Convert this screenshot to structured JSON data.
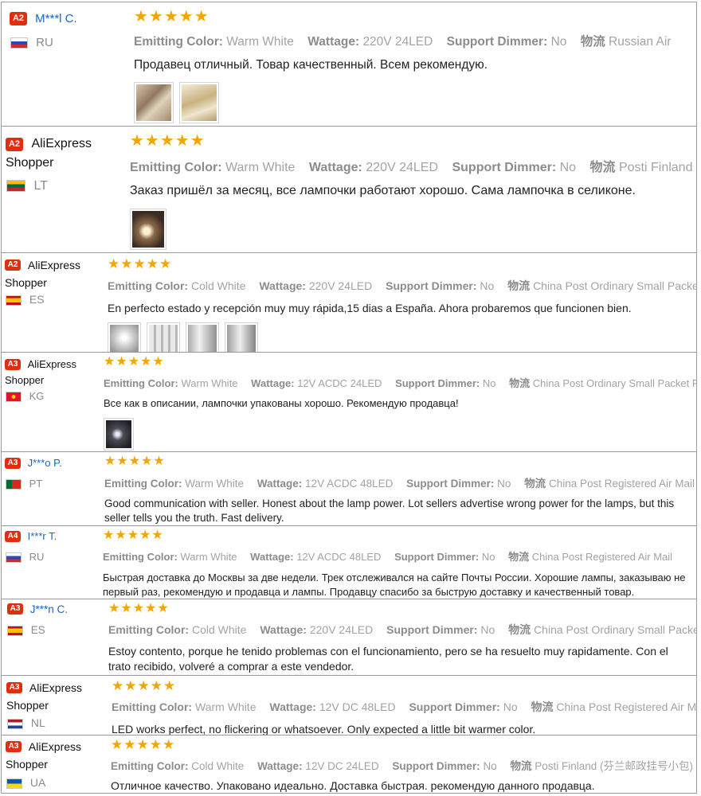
{
  "labels": {
    "emitting_color": "Emitting Color:",
    "wattage": "Wattage:",
    "support_dimmer": "Support Dimmer:",
    "shipping": "物流"
  },
  "star_rating": "★★★★★",
  "colors": {
    "star": "#f5a500",
    "level_badge": "#e02f10",
    "user_link": "#1766c7"
  },
  "reviews": [
    {
      "level": "A2",
      "user": "M***l C.",
      "country": "RU",
      "rating": 5,
      "emitting_color": "Warm White",
      "wattage": "220V 24LED",
      "support_dimmer": "No",
      "shipping": "Russian Air",
      "text": "Продавец отличный. Товар качественный. Всем рекомендую."
    },
    {
      "level": "A2",
      "user": "AliExpress Shopper",
      "country": "LT",
      "rating": 5,
      "emitting_color": "Warm White",
      "wattage": "220V 24LED",
      "support_dimmer": "No",
      "shipping": "Posti Finland",
      "text": "Заказ пришёл за месяц, все лампочки работают хорошо. Сама лампочка в селиконе."
    },
    {
      "level": "A2",
      "user": "AliExpress Shopper",
      "country": "ES",
      "rating": 5,
      "emitting_color": "Cold White",
      "wattage": "220V 24LED",
      "support_dimmer": "No",
      "shipping": "China Post Ordinary Small Packet Plus",
      "text": "En perfecto estado y recepción muy muy rápida,15 dias a España. Ahora probaremos que funcionen bien."
    },
    {
      "level": "A3",
      "user": "AliExpress Shopper",
      "country": "KG",
      "rating": 5,
      "emitting_color": "Warm White",
      "wattage": "12V ACDC 24LED",
      "support_dimmer": "No",
      "shipping": "China Post Ordinary Small Packet Plus",
      "text": "Все как в описании, лампочки упакованы хорошо. Рекомендую продавца!"
    },
    {
      "level": "A3",
      "user": "J***o P.",
      "country": "PT",
      "rating": 5,
      "emitting_color": "Warm White",
      "wattage": "12V ACDC 48LED",
      "support_dimmer": "No",
      "shipping": "China Post Registered Air Mail",
      "text": "Good communication with seller. Honest about the lamp power. Lot sellers advertise wrong power for the lamps, but this seller tells you the truth. Fast delivery."
    },
    {
      "level": "A4",
      "user": "I***r T.",
      "country": "RU",
      "rating": 5,
      "emitting_color": "Warm White",
      "wattage": "12V ACDC 48LED",
      "support_dimmer": "No",
      "shipping": "China Post Registered Air Mail",
      "text": "Быстрая доставка до Москвы за две недели. Трек отслеживался на сайте Почты России. Хорошие лампы, заказываю не первый раз, рекомендую и продавца и лампы. Продавцу спасибо за быструю доставку и качественный товар."
    },
    {
      "level": "A3",
      "user": "J***n C.",
      "country": "ES",
      "rating": 5,
      "emitting_color": "Cold White",
      "wattage": "220V 24LED",
      "support_dimmer": "No",
      "shipping": "China Post Ordinary Small Packet Plus",
      "text": "Estoy contento, porque he tenido problemas con el funcionamiento, pero se ha resuelto muy rapidamente. Con el trato recibido, volveré a comprar a este vendedor."
    },
    {
      "level": "A3",
      "user": "AliExpress Shopper",
      "country": "NL",
      "rating": 5,
      "emitting_color": "Warm White",
      "wattage": "12V DC 48LED",
      "support_dimmer": "No",
      "shipping": "China Post Registered Air Mail",
      "text": "LED works perfect, no flickering or whatsoever. Only expected a little bit warmer color."
    },
    {
      "level": "A3",
      "user": "AliExpress Shopper",
      "country": "UA",
      "rating": 5,
      "emitting_color": "Cold White",
      "wattage": "12V DC 24LED",
      "support_dimmer": "No",
      "shipping": "Posti Finland (芬兰邮政挂号小包)",
      "text": "Отличное качество. Упаковано идеально. Доставка быстрая. рекомендую данного продавца."
    }
  ]
}
